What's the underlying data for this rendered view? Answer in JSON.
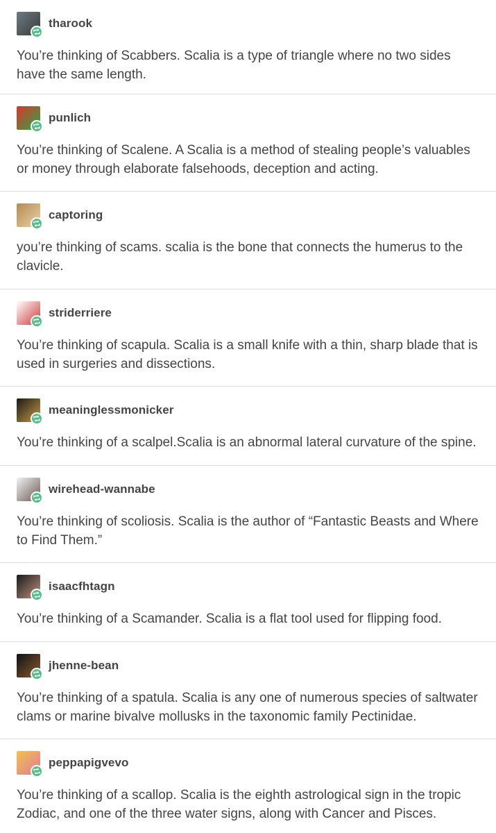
{
  "posts": [
    {
      "username": "tharook",
      "text": "You’re thinking of Scabbers. Scalia is a type of triangle where no two sides have the same length.",
      "avatar_colors": [
        "#6a7b86",
        "#3b3a35"
      ]
    },
    {
      "username": "punlich",
      "text": "You’re thinking of Scalene. A Scalia is a method of stealing people’s valuables or money through elaborate falsehoods, deception and acting.",
      "avatar_colors": [
        "#d43a2a",
        "#2aa84a"
      ]
    },
    {
      "username": "captoring",
      "text": "you’re thinking of scams. scalia is the bone that connects the humerus to the clavicle.",
      "avatar_colors": [
        "#b78a55",
        "#e9d3a8"
      ]
    },
    {
      "username": "striderriere",
      "text": "You’re thinking of scapula. Scalia is a small knife with a thin, sharp blade that is used in surgeries and dissections.",
      "avatar_colors": [
        "#ffffff",
        "#d0383a"
      ]
    },
    {
      "username": "meaninglessmonicker",
      "text": "You’re thinking of a scalpel.Scalia is an abnormal lateral curvature of the spine.",
      "avatar_colors": [
        "#1c1a16",
        "#c69a44"
      ]
    },
    {
      "username": "wirehead-wannabe",
      "text": "You’re thinking of scoliosis. Scalia is the author of “Fantastic Beasts and Where to Find Them.”",
      "avatar_colors": [
        "#f2f2f2",
        "#6b5a55"
      ]
    },
    {
      "username": "isaacfhtagn",
      "text": "You’re thinking of a Scamander. Scalia is a flat tool used for flipping food.",
      "avatar_colors": [
        "#1a1a1a",
        "#c09080"
      ]
    },
    {
      "username": "jhenne-bean",
      "text": "You’re thinking of a spatula. Scalia is any one of numerous species of saltwater clams or marine bivalve mollusks in the taxonomic family Pectinidae.",
      "avatar_colors": [
        "#111111",
        "#8a5a30"
      ]
    },
    {
      "username": "peppapigvevo",
      "text": "You’re thinking of a scallop. Scalia is the eighth astrological sign in the tropic Zodiac, and one of the three water signs, along with Cancer and Pisces.",
      "avatar_colors": [
        "#f2c14e",
        "#e27a9a"
      ]
    }
  ],
  "reblog_badge_color": "#56bc8a"
}
